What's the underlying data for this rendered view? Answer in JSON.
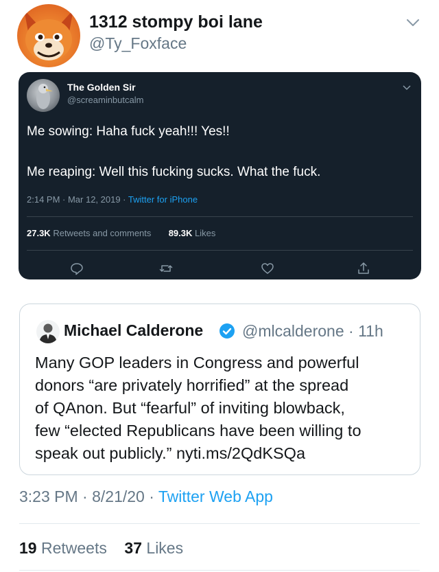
{
  "outer_tweet": {
    "display_name": "1312 stompy boi lane",
    "handle": "@Ty_Foxface",
    "avatar": "fox-avatar-icon",
    "menu_icon": "chevron-down-icon",
    "timestamp": "3:23 PM · 8/21/20 · ",
    "source": "Twitter Web App",
    "retweets_count": "19",
    "retweets_label": "Retweets",
    "likes_count": "37",
    "likes_label": "Likes"
  },
  "screenshot_tweet": {
    "display_name": "The Golden Sir",
    "handle": "@screaminbutcalm",
    "avatar": "bird-avatar-icon",
    "menu_icon": "chevron-down-icon",
    "line1": "Me sowing: Haha fuck yeah!!! Yes!!",
    "line2": "Me reaping: Well this fucking sucks. What the fuck.",
    "timestamp": "2:14 PM · Mar 12, 2019 · ",
    "source": "Twitter for iPhone",
    "retweets_count": "27.3K",
    "retweets_label": "Retweets and comments",
    "likes_count": "89.3K",
    "likes_label": "Likes",
    "actions": [
      "reply-icon",
      "retweet-icon",
      "like-icon",
      "share-icon"
    ],
    "background": "#15202b"
  },
  "quoted_tweet": {
    "display_name": "Michael Calderone",
    "verified": true,
    "handle": "@mlcalderone · 11h",
    "text_lines": [
      "Many GOP leaders in Congress and powerful",
      "donors “are privately horrified” at the spread",
      "of QAnon. But “fearful” of inviting blowback,",
      "few “elected Republicans have been willing to",
      "speak out publicly.” nyti.ms/2QdKSQa"
    ]
  },
  "colors": {
    "accent": "#1da1f2",
    "secondary_text": "#657786",
    "border": "#ccd6dd"
  }
}
